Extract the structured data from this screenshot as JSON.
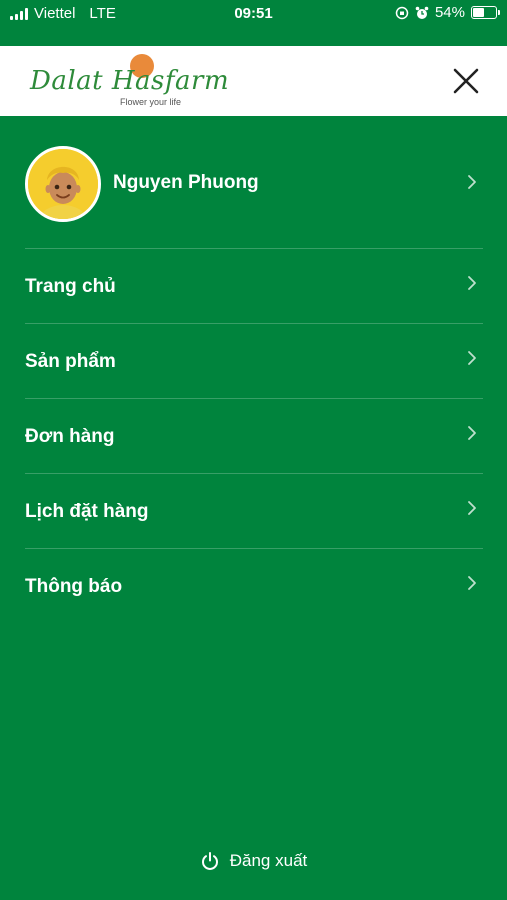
{
  "status_bar": {
    "carrier": "Viettel",
    "network": "LTE",
    "time": "09:51",
    "battery": "54%",
    "battery_level": 0.54
  },
  "header": {
    "logo_name": "Dalat Hasfarm",
    "logo_tagline": "Flower your life",
    "close_icon": "close-icon"
  },
  "profile": {
    "name": "Nguyen Phuong",
    "avatar_icon": "avatar-boy-icon"
  },
  "menu": {
    "items": [
      {
        "label": "Trang chủ"
      },
      {
        "label": "Sản phẩm"
      },
      {
        "label": "Đơn hàng"
      },
      {
        "label": "Lịch đặt hàng"
      },
      {
        "label": "Thông báo"
      }
    ]
  },
  "logout": {
    "label": "Đăng xuất",
    "icon": "power-icon"
  },
  "colors": {
    "primary_green": "#00843d",
    "header_bg": "#ffffff",
    "logo_green": "#2e8b3a",
    "logo_sun": "#e98a3a"
  }
}
